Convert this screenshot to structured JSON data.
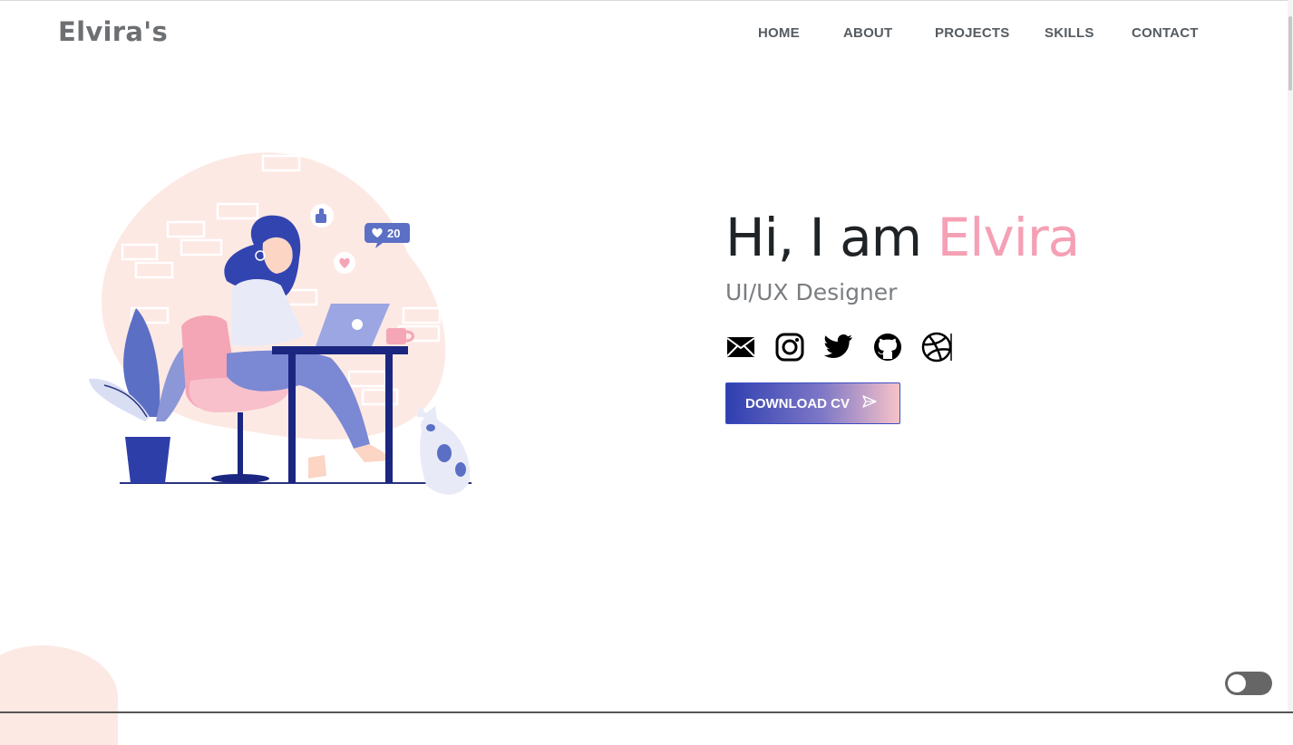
{
  "header": {
    "brand": "Elvira's"
  },
  "nav": {
    "items": [
      "HOME",
      "ABOUT",
      "PROJECTS",
      "SKILLS",
      "CONTACT"
    ]
  },
  "hero": {
    "greeting": "Hi, I am",
    "name": "Elvira",
    "role": "UI/UX Designer",
    "download_label": "DOWNLOAD CV",
    "socials": [
      "email-icon",
      "instagram-icon",
      "twitter-icon",
      "github-icon",
      "dribbble-icon"
    ]
  },
  "illustration": {
    "like_count": "20"
  },
  "colors": {
    "accent_pink": "#f5a0b5",
    "brand_blue": "#2f3fb0",
    "text_dark": "#1f2326",
    "nav_gray": "#555b60"
  }
}
